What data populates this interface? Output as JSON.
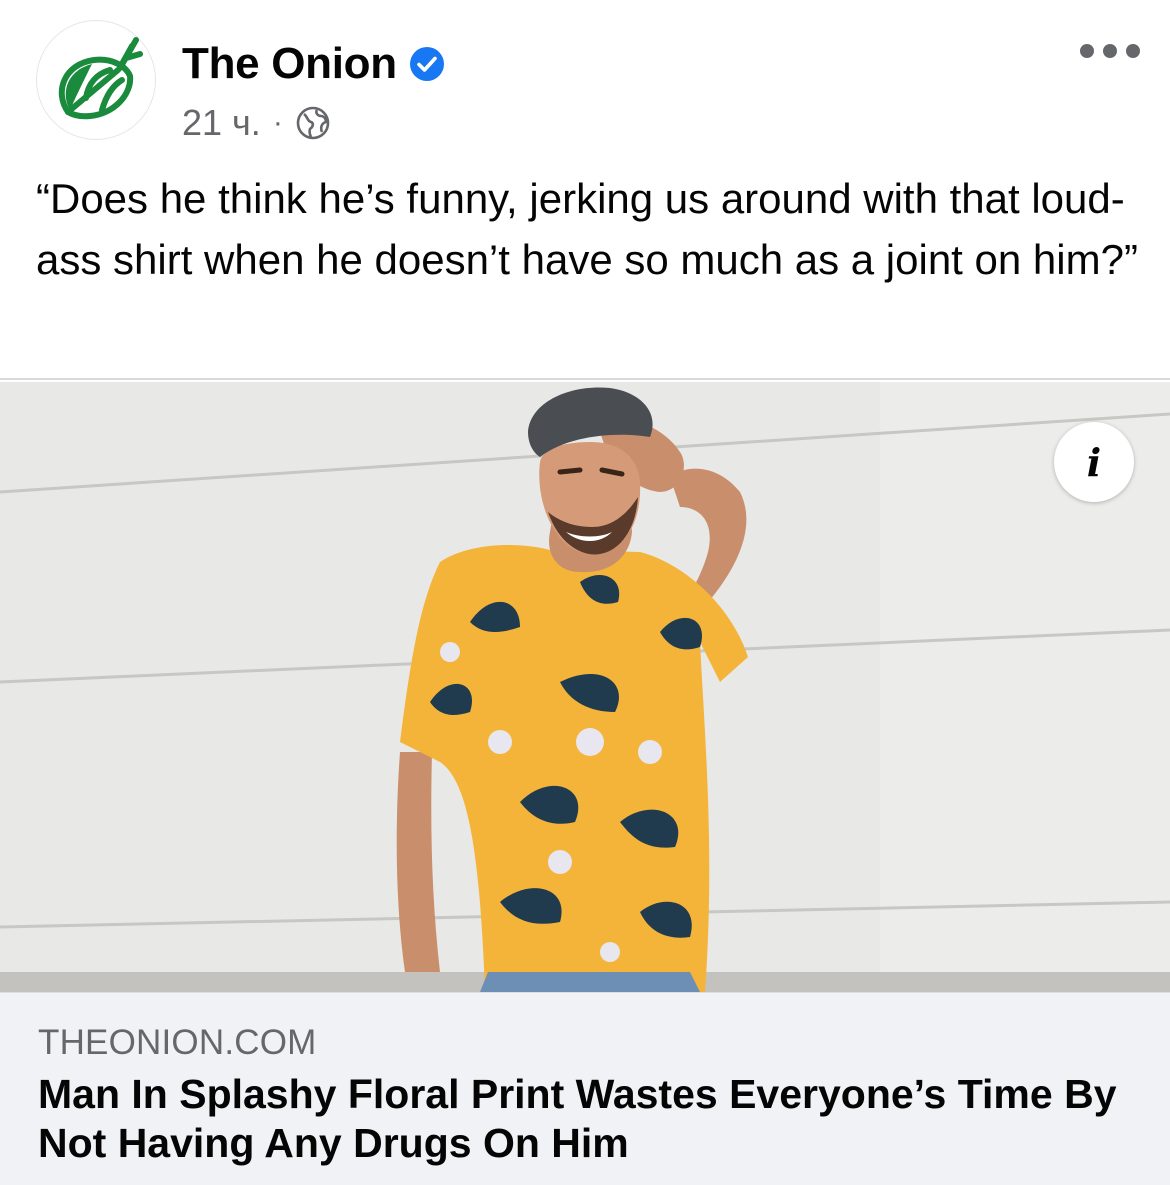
{
  "post": {
    "page_name": "The Onion",
    "verified_icon": "verified-badge-icon",
    "time_ago": "21 ч.",
    "separator": "·",
    "privacy_icon": "globe-icon",
    "text": "“Does he think he’s funny, jerking us around with that loud-ass shirt when he doesn’t have so much as a joint on him?”"
  },
  "link": {
    "domain": "THEONION.COM",
    "title": "Man In Splashy Floral Print Wastes Everyone’s Time By Not Having Any Drugs On Him",
    "info_label": "i"
  },
  "colors": {
    "onion_green": "#1a8a3d",
    "verified_blue": "#1877f2",
    "secondary_text": "#65676b",
    "shirt_yellow": "#f4b43a",
    "footer_bg": "#f0f2f5"
  }
}
